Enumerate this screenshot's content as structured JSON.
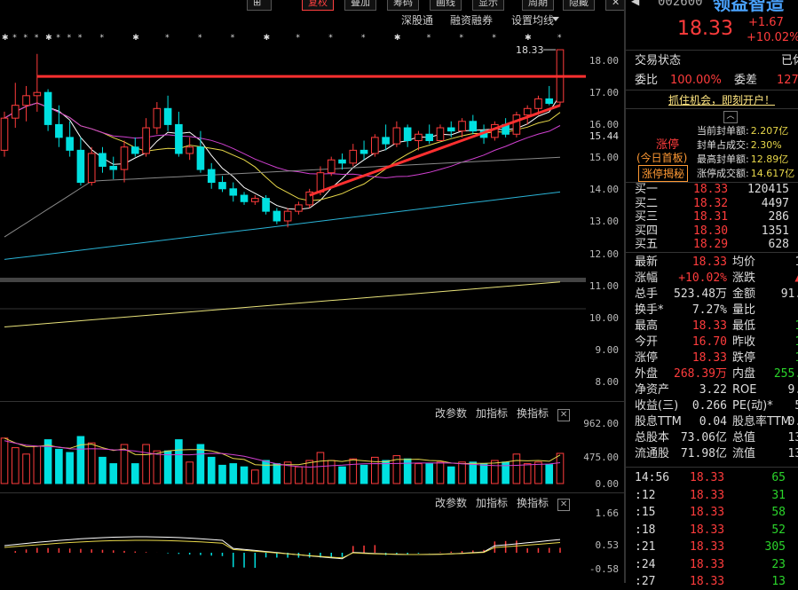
{
  "toolbar": {
    "buttons": [
      "复权",
      "叠加",
      "筹码",
      "画线",
      "显示",
      "周期",
      "隐藏"
    ],
    "links": [
      "深股通",
      "融资融券",
      "设置均线"
    ]
  },
  "price_axis": [
    "18.00",
    "17.00",
    "16.00",
    "15.44",
    "15.00",
    "14.00",
    "13.00",
    "12.00",
    "11.00",
    "10.00",
    "9.00",
    "8.00"
  ],
  "current_price_label": "18.33",
  "volume_axis": [
    "962.00",
    "475.00",
    "0.00"
  ],
  "macd_axis": [
    "1.66",
    "0.53",
    "-0.58"
  ],
  "panel_tools": [
    "改参数",
    "加指标",
    "换指标"
  ],
  "quote": {
    "code": "002600",
    "name": "领益智造",
    "price": "18.33",
    "change": "+1.67",
    "change_pct": "+10.02%",
    "status_label": "交易状态",
    "status_value": "已休",
    "wb_label": "委比",
    "wb_value": "100.00%",
    "wc_label": "委差",
    "wc_value": "1271",
    "banner": "抓住机会，即刻开户！",
    "limit_title": "涨停",
    "limit_sub": "(今日首板)",
    "limit_btn": "涨停揭秘",
    "limit_rows": [
      {
        "label": "当前封单额:",
        "value": "2.207亿"
      },
      {
        "label": "封单占成交:",
        "value": "2.30%"
      },
      {
        "label": "最高封单额:",
        "value": "12.89亿"
      },
      {
        "label": "涨停成交额:",
        "value": "14.617亿"
      }
    ],
    "order_book": [
      {
        "label": "买一",
        "price": "18.33",
        "vol": "120415"
      },
      {
        "label": "买二",
        "price": "18.32",
        "vol": "4497"
      },
      {
        "label": "买三",
        "price": "18.31",
        "vol": "286"
      },
      {
        "label": "买四",
        "price": "18.30",
        "vol": "1351"
      },
      {
        "label": "买五",
        "price": "18.29",
        "vol": "628"
      }
    ],
    "stats": [
      {
        "l1": "最新",
        "v1": "18.33",
        "l2": "均价",
        "v2": "17"
      },
      {
        "l1": "涨幅",
        "v1": "+10.02%",
        "l2": "涨跌",
        "v2": "▲1"
      },
      {
        "l1": "总手",
        "v1": "523.48万",
        "l2": "金额",
        "v2": "91.5"
      },
      {
        "l1": "换手*",
        "v1": "7.27%",
        "l2": "量比",
        "v2": "1"
      },
      {
        "l1": "最高",
        "v1": "18.33",
        "l2": "最低",
        "v2": "16"
      },
      {
        "l1": "今开",
        "v1": "16.70",
        "l2": "昨收",
        "v2": "16"
      },
      {
        "l1": "涨停",
        "v1": "18.33",
        "l2": "跌停",
        "v2": "14"
      },
      {
        "l1": "外盘",
        "v1": "268.39万",
        "l2": "内盘",
        "v2": "255.0"
      },
      {
        "l1": "净资产",
        "v1": "3.22",
        "l2": "ROE",
        "v2": "9.4"
      },
      {
        "l1": "收益(三)",
        "v1": "0.266",
        "l2": "PE(动)*",
        "v2": "51"
      },
      {
        "l1": "股息TTM",
        "v1": "0.04",
        "l2": "股息率TTM",
        "v2": "0.2"
      },
      {
        "l1": "总股本",
        "v1": "73.06亿",
        "l2": "总值",
        "v2": "133"
      },
      {
        "l1": "流通股",
        "v1": "71.98亿",
        "l2": "流值",
        "v2": "131"
      }
    ],
    "ticks": [
      {
        "time": "14:56",
        "price": "18.33",
        "vol": "65"
      },
      {
        "time": ":12",
        "price": "18.33",
        "vol": "31"
      },
      {
        "time": ":15",
        "price": "18.33",
        "vol": "58"
      },
      {
        "time": ":18",
        "price": "18.33",
        "vol": "52"
      },
      {
        "time": ":21",
        "price": "18.33",
        "vol": "305"
      },
      {
        "time": ":24",
        "price": "18.33",
        "vol": "23"
      },
      {
        "time": ":27",
        "price": "18.33",
        "vol": "13"
      }
    ]
  },
  "chart_data": {
    "type": "candlestick",
    "ylim": [
      7.6,
      18.8
    ],
    "current_price": 18.33,
    "candles": [
      {
        "o": 15.2,
        "h": 16.4,
        "l": 15.0,
        "c": 16.2
      },
      {
        "o": 16.2,
        "h": 17.3,
        "l": 15.9,
        "c": 16.6
      },
      {
        "o": 16.6,
        "h": 17.2,
        "l": 16.1,
        "c": 16.9
      },
      {
        "o": 16.9,
        "h": 18.2,
        "l": 16.4,
        "c": 17.0
      },
      {
        "o": 17.0,
        "h": 17.1,
        "l": 15.8,
        "c": 16.0
      },
      {
        "o": 16.0,
        "h": 16.6,
        "l": 15.3,
        "c": 15.6
      },
      {
        "o": 15.6,
        "h": 16.1,
        "l": 15.0,
        "c": 15.2
      },
      {
        "o": 15.2,
        "h": 15.6,
        "l": 14.1,
        "c": 14.2
      },
      {
        "o": 14.2,
        "h": 15.3,
        "l": 14.1,
        "c": 15.1
      },
      {
        "o": 15.1,
        "h": 15.3,
        "l": 14.5,
        "c": 14.7
      },
      {
        "o": 14.7,
        "h": 15.0,
        "l": 14.3,
        "c": 14.6
      },
      {
        "o": 14.6,
        "h": 15.5,
        "l": 14.2,
        "c": 15.3
      },
      {
        "o": 15.3,
        "h": 15.6,
        "l": 15.0,
        "c": 15.1
      },
      {
        "o": 15.1,
        "h": 16.2,
        "l": 15.0,
        "c": 15.9
      },
      {
        "o": 15.9,
        "h": 16.7,
        "l": 15.7,
        "c": 16.5
      },
      {
        "o": 16.5,
        "h": 16.9,
        "l": 15.8,
        "c": 16.0
      },
      {
        "o": 16.0,
        "h": 16.4,
        "l": 15.0,
        "c": 15.1
      },
      {
        "o": 15.1,
        "h": 15.6,
        "l": 14.9,
        "c": 15.3
      },
      {
        "o": 15.3,
        "h": 15.8,
        "l": 14.5,
        "c": 14.6
      },
      {
        "o": 14.6,
        "h": 14.8,
        "l": 14.0,
        "c": 14.2
      },
      {
        "o": 14.2,
        "h": 14.4,
        "l": 13.9,
        "c": 14.0
      },
      {
        "o": 14.0,
        "h": 14.2,
        "l": 13.6,
        "c": 13.8
      },
      {
        "o": 13.8,
        "h": 13.9,
        "l": 13.5,
        "c": 13.6
      },
      {
        "o": 13.6,
        "h": 13.8,
        "l": 13.5,
        "c": 13.7
      },
      {
        "o": 13.7,
        "h": 13.8,
        "l": 13.2,
        "c": 13.3
      },
      {
        "o": 13.3,
        "h": 13.4,
        "l": 12.9,
        "c": 13.0
      },
      {
        "o": 13.0,
        "h": 13.4,
        "l": 12.8,
        "c": 13.3
      },
      {
        "o": 13.3,
        "h": 13.6,
        "l": 13.2,
        "c": 13.5
      },
      {
        "o": 13.5,
        "h": 14.0,
        "l": 13.4,
        "c": 13.9
      },
      {
        "o": 13.9,
        "h": 14.7,
        "l": 13.8,
        "c": 14.5
      },
      {
        "o": 14.5,
        "h": 15.0,
        "l": 14.4,
        "c": 14.9
      },
      {
        "o": 14.9,
        "h": 15.1,
        "l": 14.6,
        "c": 14.8
      },
      {
        "o": 14.8,
        "h": 15.4,
        "l": 14.7,
        "c": 15.2
      },
      {
        "o": 15.2,
        "h": 15.5,
        "l": 14.9,
        "c": 15.1
      },
      {
        "o": 15.1,
        "h": 15.7,
        "l": 15.0,
        "c": 15.6
      },
      {
        "o": 15.6,
        "h": 16.0,
        "l": 15.2,
        "c": 15.4
      },
      {
        "o": 15.4,
        "h": 16.1,
        "l": 15.3,
        "c": 15.9
      },
      {
        "o": 15.9,
        "h": 16.0,
        "l": 15.3,
        "c": 15.5
      },
      {
        "o": 15.5,
        "h": 15.8,
        "l": 15.2,
        "c": 15.7
      },
      {
        "o": 15.7,
        "h": 16.0,
        "l": 15.4,
        "c": 15.5
      },
      {
        "o": 15.5,
        "h": 16.0,
        "l": 15.5,
        "c": 15.9
      },
      {
        "o": 15.9,
        "h": 16.1,
        "l": 15.6,
        "c": 15.8
      },
      {
        "o": 15.8,
        "h": 16.2,
        "l": 15.6,
        "c": 16.1
      },
      {
        "o": 16.1,
        "h": 16.3,
        "l": 15.7,
        "c": 15.8
      },
      {
        "o": 15.8,
        "h": 16.0,
        "l": 15.4,
        "c": 15.6
      },
      {
        "o": 15.6,
        "h": 16.1,
        "l": 15.5,
        "c": 16.0
      },
      {
        "o": 16.0,
        "h": 16.2,
        "l": 15.6,
        "c": 15.7
      },
      {
        "o": 15.7,
        "h": 16.4,
        "l": 15.6,
        "c": 16.3
      },
      {
        "o": 16.3,
        "h": 16.6,
        "l": 16.0,
        "c": 16.5
      },
      {
        "o": 16.5,
        "h": 16.9,
        "l": 16.3,
        "c": 16.8
      },
      {
        "o": 16.8,
        "h": 17.2,
        "l": 16.6,
        "c": 16.66
      },
      {
        "o": 16.7,
        "h": 18.33,
        "l": 16.6,
        "c": 18.33
      }
    ],
    "annotations": {
      "resistance": 17.5,
      "trend_start": [
        28,
        13.8
      ],
      "trend_end": [
        51,
        16.6
      ]
    }
  }
}
